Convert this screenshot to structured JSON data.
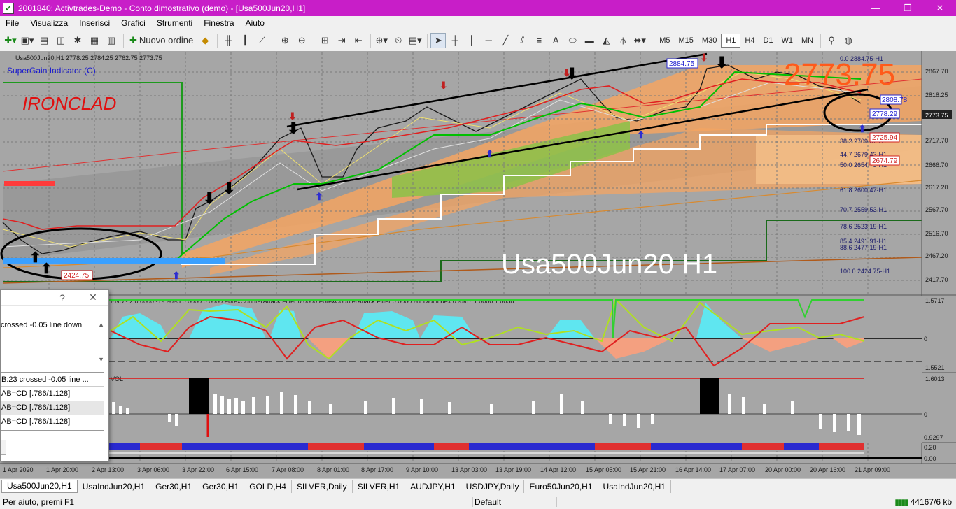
{
  "window": {
    "title": "2001840: Activtrades-Demo - Conto dimostrativo (demo) - [Usa500Jun20,H1]"
  },
  "menu": [
    "File",
    "Visualizza",
    "Inserisci",
    "Grafici",
    "Strumenti",
    "Finestra",
    "Aiuto"
  ],
  "toolbar": {
    "new_order": "Nuovo ordine",
    "timeframes": [
      "M5",
      "M15",
      "M30",
      "H1",
      "H4",
      "D1",
      "W1",
      "MN"
    ],
    "active_timeframe": "H1"
  },
  "chart": {
    "info": "Usa500Jun20,H1  2778.25 2784.25 2762.75 2773.75",
    "indicator_name": "SuperGain Indicator (C)",
    "logo_text": "IRONCLAD",
    "watermark": "Usa500Jun20 H1",
    "big_price": "2773.75",
    "price_labels": {
      "p1": "2884.75",
      "p2": "2424.75",
      "p3": "2808.78",
      "p4": "2778.29",
      "p5": "2725.94",
      "p6": "2674.79"
    },
    "fib_levels": [
      "0.0 2884.75-H1",
      "38.2 2709.07-H1",
      "44.7 2679.43-H1",
      "50.0 2654.75-H1",
      "61.8 2600.47-H1",
      "70.7 2559.53-H1",
      "78.6 2523.19-H1",
      "85.4 2491.91-H1",
      "88.6 2477.19-H1",
      "100.0 2424.75-H1"
    ],
    "price_axis": [
      "2867.70",
      "2818.25",
      "2773.75",
      "2717.70",
      "2666.70",
      "2617.20",
      "2567.70",
      "2516.70",
      "2467.20",
      "2417.70"
    ],
    "time_axis": [
      "1 Apr 2020",
      "1 Apr 20:00",
      "2 Apr 13:00",
      "3 Apr 06:00",
      "3 Apr 22:00",
      "6 Apr 15:00",
      "7 Apr 08:00",
      "8 Apr 01:00",
      "8 Apr 17:00",
      "9 Apr 10:00",
      "13 Apr 03:00",
      "13 Apr 19:00",
      "14 Apr 12:00",
      "15 Apr 05:00",
      "15 Apr 21:00",
      "16 Apr 14:00",
      "17 Apr 07:00",
      "20 Apr 00:00",
      "20 Apr 16:00",
      "21 Apr 09:00"
    ],
    "sub1_header": "END - 2 0.0000 -19.9095 0.0000 0.0000  ForexCounterAttack Filter 0.0000  ForexCounterAttack Filter 0.0000  H1 Didi index 0.9967 1.0000 1.0058",
    "sub1_axis": [
      "1.5717",
      "0",
      "1.5521"
    ],
    "sub2_header": "VOL",
    "sub2_axis": [
      "1.6013",
      "0",
      "0.9297",
      "0.20"
    ],
    "sub3_axis": [
      "0.00"
    ]
  },
  "dialog": {
    "help": "?",
    "close": "✕",
    "message": "crossed -0.05 line down",
    "items": [
      "B:23 crossed -0.05 line ...",
      "AB=CD [.786/1.128]",
      "AB=CD [.786/1.128]",
      "AB=CD [.786/1.128]"
    ]
  },
  "tabs": [
    "Usa500Jun20,H1",
    "UsaIndJun20,H1",
    "Ger30,H1",
    "Ger30,H1",
    "GOLD,H4",
    "SILVER,Daily",
    "SILVER,H1",
    "AUDJPY,H1",
    "USDJPY,Daily",
    "Euro50Jun20,H1",
    "UsaIndJun20,H1"
  ],
  "status": {
    "help": "Per aiuto, premi F1",
    "profile": "Default",
    "traffic": "44167/6 kb"
  }
}
